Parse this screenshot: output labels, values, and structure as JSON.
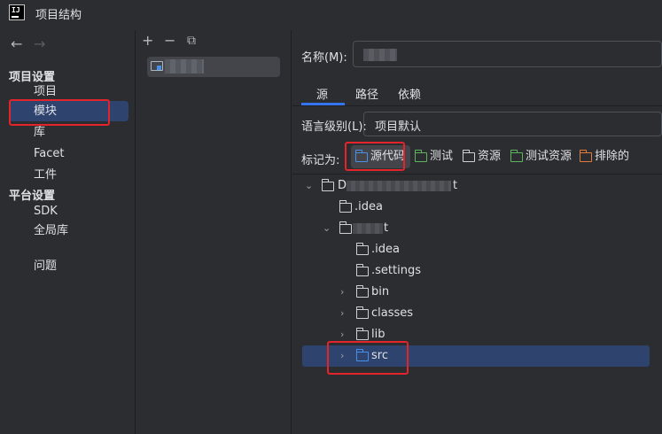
{
  "window": {
    "title": "项目结构",
    "logo_text": "IJ"
  },
  "nav": {
    "back": "←",
    "forward": "→",
    "sections": [
      {
        "label": "项目设置",
        "items": [
          "项目",
          "模块",
          "库",
          "Facet",
          "工件"
        ]
      },
      {
        "label": "平台设置",
        "items": [
          "SDK",
          "全局库"
        ]
      }
    ],
    "extra": "问题",
    "selected": "模块"
  },
  "module_toolbar": {
    "add": "+",
    "remove": "−",
    "copy": "⧉"
  },
  "module": {
    "name_label": "名称(M):",
    "tabs": [
      "源",
      "路径",
      "依赖"
    ],
    "active_tab": "源",
    "language_level_label": "语言级别(L):",
    "language_level_value": "项目默认",
    "mark_as_label": "标记为:",
    "mark_as": [
      {
        "label": "源代码",
        "color": "#4a8fe7",
        "active": true
      },
      {
        "label": "测试",
        "color": "#5fb35f",
        "active": false
      },
      {
        "label": "资源",
        "color": "#ced0d6",
        "active": false
      },
      {
        "label": "测试资源",
        "color": "#5fb35f",
        "active": false
      },
      {
        "label": "排除的",
        "color": "#e07b3b",
        "active": false
      }
    ]
  },
  "tree": {
    "root_prefix": "D",
    "root_suffix": "t",
    "items": [
      ".idea",
      "t",
      ".idea",
      ".settings",
      "bin",
      "classes",
      "lib",
      "src"
    ],
    "selected": "src"
  },
  "colors": {
    "accent": "#3574f0",
    "selection": "#2e436e",
    "highlight": "#e3242b",
    "source_folder": "#4a8fe7"
  }
}
